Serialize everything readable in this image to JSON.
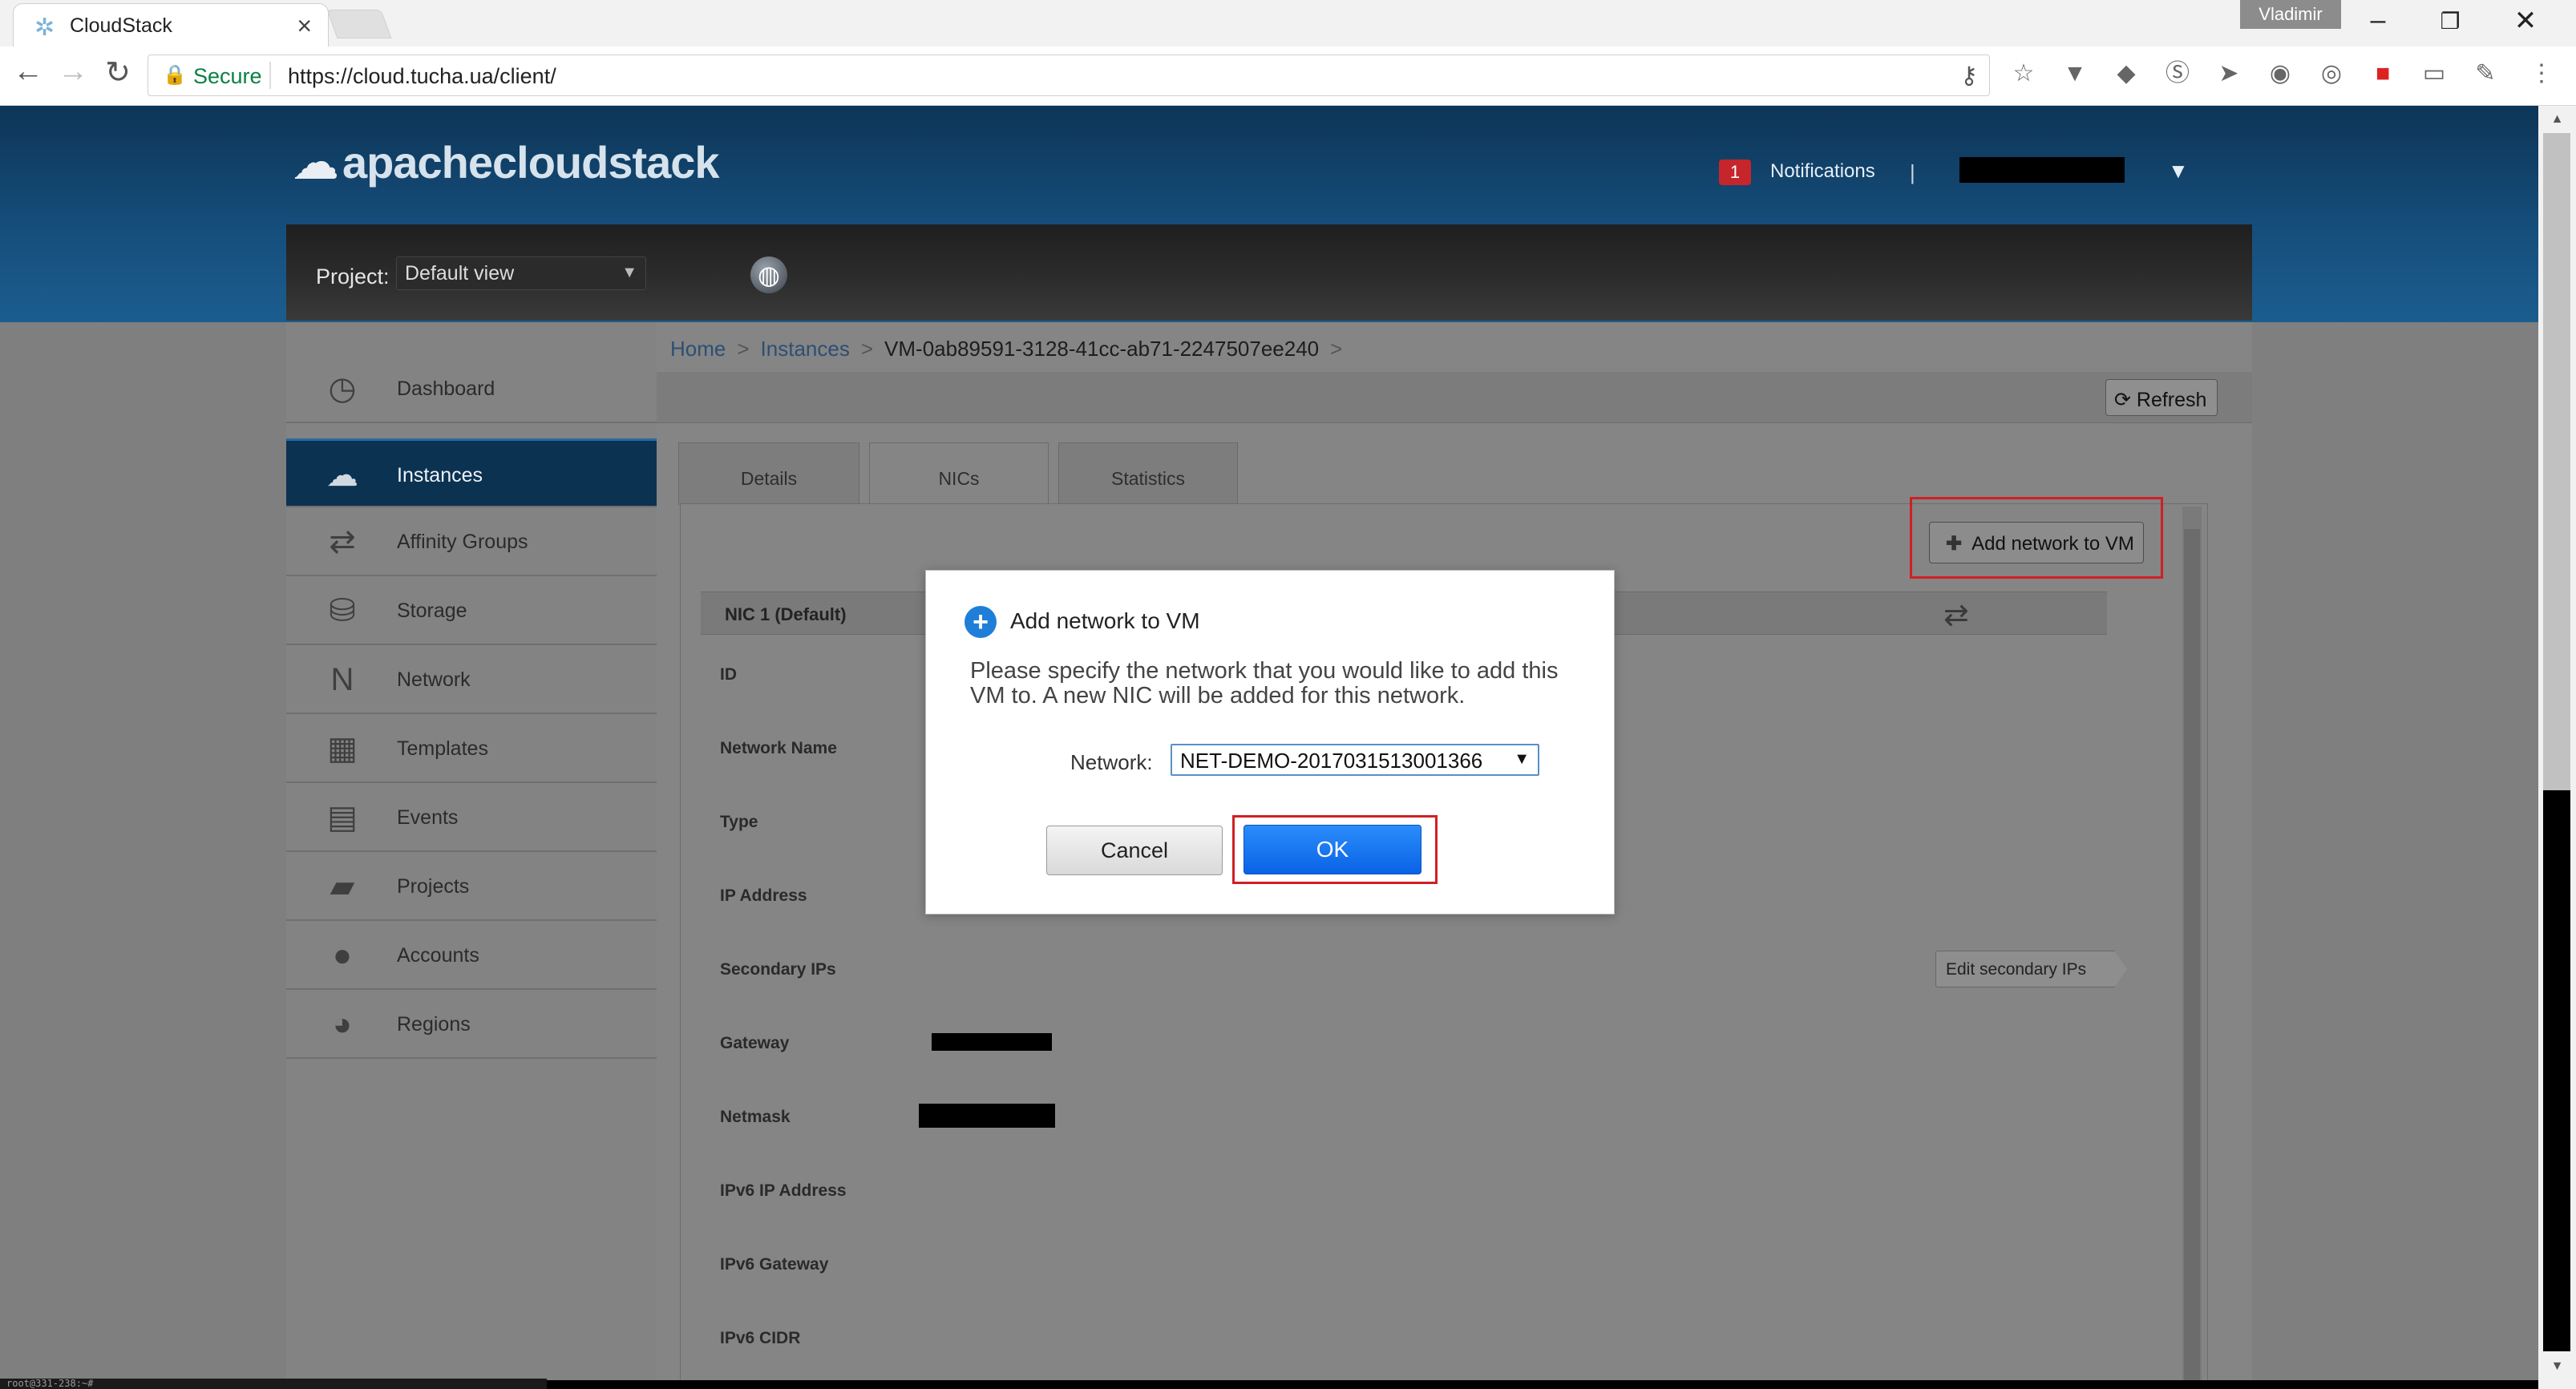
{
  "browser": {
    "tab_title": "CloudStack",
    "profile_name": "Vladimir",
    "secure_label": "Secure",
    "url": "https://cloud.tucha.ua/client/"
  },
  "header": {
    "logo_text": "apachecloudstack",
    "notifications_count": "1",
    "notifications_label": "Notifications",
    "separator": "|"
  },
  "project": {
    "label": "Project:",
    "selected": "Default view"
  },
  "sidebar": {
    "items": [
      {
        "label": "Dashboard",
        "icon": "gauge-icon"
      },
      {
        "label": "Instances",
        "icon": "cloud-icon"
      },
      {
        "label": "Affinity Groups",
        "icon": "affinity-icon"
      },
      {
        "label": "Storage",
        "icon": "disk-icon"
      },
      {
        "label": "Network",
        "icon": "network-icon"
      },
      {
        "label": "Templates",
        "icon": "templates-icon"
      },
      {
        "label": "Events",
        "icon": "calendar-icon"
      },
      {
        "label": "Projects",
        "icon": "folder-icon"
      },
      {
        "label": "Accounts",
        "icon": "user-icon"
      },
      {
        "label": "Regions",
        "icon": "globe-icon"
      }
    ],
    "active_index": 1
  },
  "breadcrumb": {
    "home": "Home",
    "instances": "Instances",
    "current": "VM-0ab89591-3128-41cc-ab71-2247507ee240",
    "sep": ">"
  },
  "toolbar": {
    "refresh_label": "Refresh"
  },
  "tabs": [
    {
      "label": "Details"
    },
    {
      "label": "NICs"
    },
    {
      "label": "Statistics"
    }
  ],
  "nics": {
    "add_button_label": "Add network to VM",
    "header_title": "NIC 1 (Default)",
    "fields": [
      {
        "label": "ID"
      },
      {
        "label": "Network Name"
      },
      {
        "label": "Type"
      },
      {
        "label": "IP Address"
      },
      {
        "label": "Secondary IPs"
      },
      {
        "label": "Gateway"
      },
      {
        "label": "Netmask"
      },
      {
        "label": "IPv6 IP Address"
      },
      {
        "label": "IPv6 Gateway"
      },
      {
        "label": "IPv6 CIDR"
      }
    ],
    "edit_secondary_label": "Edit secondary IPs"
  },
  "dialog": {
    "title": "Add network to VM",
    "message": "Please specify the network that you would like to add this VM to. A new NIC will be added for this network.",
    "network_label": "Network:",
    "network_selected": "NET-DEMO-20170315130013​66",
    "cancel_label": "Cancel",
    "ok_label": "OK"
  },
  "terminal": {
    "text": "root@331-238:~#"
  },
  "colors": {
    "header_blue": "#164f7d",
    "active_nav": "#0c3251",
    "ok_blue": "#0a62e6",
    "highlight_red": "#d01f26",
    "notification_red": "#c6262b"
  }
}
